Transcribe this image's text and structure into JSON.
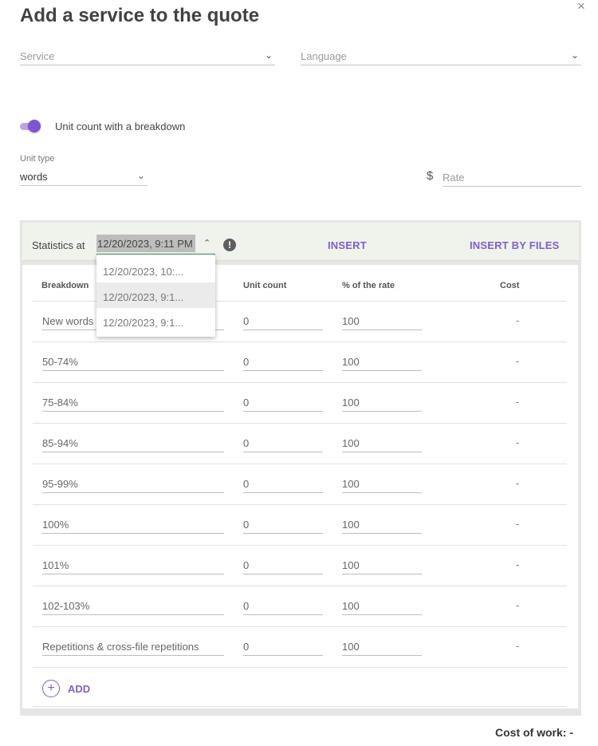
{
  "header": {
    "title": "Add a service to the quote",
    "close_label": "×"
  },
  "service": {
    "placeholder": "Service"
  },
  "language": {
    "placeholder": "Language"
  },
  "toggle": {
    "label": "Unit count with a breakdown",
    "on": true,
    "accent": "#7c55d1"
  },
  "unit_type": {
    "label": "Unit type",
    "value": "words"
  },
  "rate": {
    "currency": "$",
    "placeholder": "Rate"
  },
  "statistics": {
    "label": "Statistics at",
    "selected": "12/20/2023, 9:11 PM",
    "insert_label": "INSERT",
    "insert_files_label": "INSERT BY FILES",
    "dropdown_options": [
      "12/20/2023, 10:...",
      "12/20/2023, 9:1...",
      "12/20/2023, 9:1..."
    ]
  },
  "table": {
    "headers": {
      "breakdown": "Breakdown",
      "unit_count": "Unit count",
      "rate_pct": "% of the rate",
      "cost": "Cost"
    },
    "rows": [
      {
        "breakdown": "New words",
        "units": "0",
        "pct": "100",
        "cost": "-"
      },
      {
        "breakdown": "50-74%",
        "units": "0",
        "pct": "100",
        "cost": "-"
      },
      {
        "breakdown": "75-84%",
        "units": "0",
        "pct": "100",
        "cost": "-"
      },
      {
        "breakdown": "85-94%",
        "units": "0",
        "pct": "100",
        "cost": "-"
      },
      {
        "breakdown": "95-99%",
        "units": "0",
        "pct": "100",
        "cost": "-"
      },
      {
        "breakdown": "100%",
        "units": "0",
        "pct": "100",
        "cost": "-"
      },
      {
        "breakdown": "101%",
        "units": "0",
        "pct": "100",
        "cost": "-"
      },
      {
        "breakdown": "102-103%",
        "units": "0",
        "pct": "100",
        "cost": "-"
      },
      {
        "breakdown": "Repetitions & cross-file repetitions",
        "units": "0",
        "pct": "100",
        "cost": "-"
      }
    ],
    "add_label": "ADD"
  },
  "footer": {
    "cost_of_work": "Cost of work: -"
  }
}
